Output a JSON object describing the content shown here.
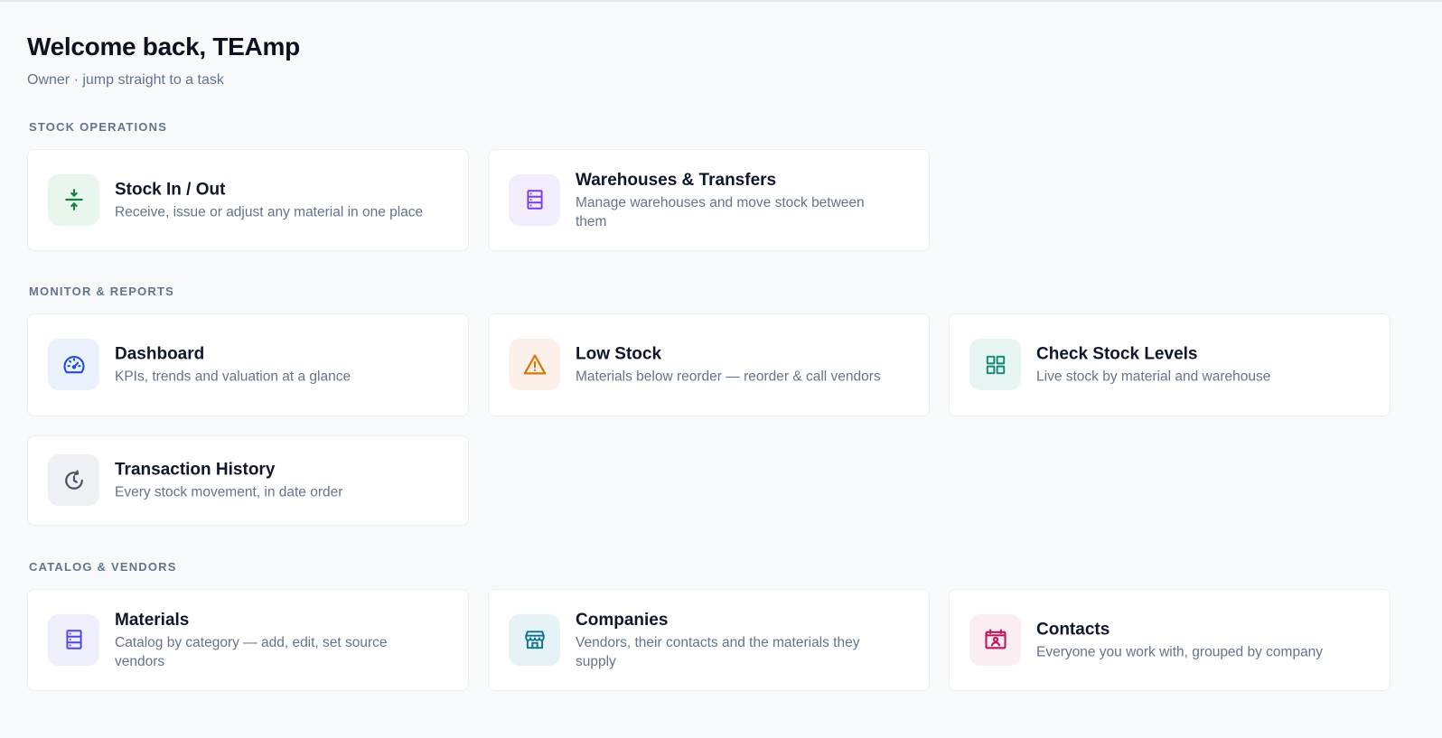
{
  "header": {
    "title": "Welcome back, TEAmp",
    "subtitle": "Owner · jump straight to a task"
  },
  "sections": [
    {
      "label": "STOCK OPERATIONS",
      "cards": [
        {
          "title": "Stock In / Out",
          "description": "Receive, issue or adjust any material in one place",
          "icon": "stock-in-out-icon",
          "color": "#15803d",
          "bg": "#e8f6ee"
        },
        {
          "title": "Warehouses & Transfers",
          "description": "Manage warehouses and move stock between them",
          "icon": "warehouse-icon",
          "color": "#7c3aed",
          "bg": "#f1edfd"
        }
      ]
    },
    {
      "label": "MONITOR & REPORTS",
      "cards": [
        {
          "title": "Dashboard",
          "description": "KPIs, trends and valuation at a glance",
          "icon": "gauge-icon",
          "color": "#1d4ed8",
          "bg": "#ebf0fd"
        },
        {
          "title": "Low Stock",
          "description": "Materials below reorder — reorder & call vendors",
          "icon": "warning-icon",
          "color": "#d97706",
          "bg": "#fdf0ea"
        },
        {
          "title": "Check Stock Levels",
          "description": "Live stock by material and warehouse",
          "icon": "grid-icon",
          "color": "#0f8a6e",
          "bg": "#e6f5f1"
        },
        {
          "title": "Transaction History",
          "description": "Every stock movement, in date order",
          "icon": "history-icon",
          "color": "#4b5563",
          "bg": "#eef0f3"
        }
      ]
    },
    {
      "label": "CATALOG & VENDORS",
      "cards": [
        {
          "title": "Materials",
          "description": "Catalog by category — add, edit, set source vendors",
          "icon": "materials-icon",
          "color": "#4f46e5",
          "bg": "#eeeefc"
        },
        {
          "title": "Companies",
          "description": "Vendors, their contacts and the materials they supply",
          "icon": "store-icon",
          "color": "#0e7490",
          "bg": "#e6f3f6"
        },
        {
          "title": "Contacts",
          "description": "Everyone you work with, grouped by company",
          "icon": "contact-card-icon",
          "color": "#be185d",
          "bg": "#fbedf1"
        }
      ]
    }
  ]
}
